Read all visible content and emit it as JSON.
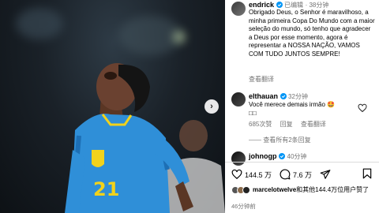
{
  "post": {
    "author": "endrick",
    "edited": "已编辑",
    "time": "38分钟",
    "caption": "Obrigado Deus, o Senhor é maravilhoso, a minha primeira Copa Do Mundo com a maior seleção do mundo, só tenho que agradecer a Deus por esse momento, agora é representar a NOSSA NAÇÃO, VAMOS COM TUDO JUNTOS SEMPRE!",
    "see_translation": "查看翻译"
  },
  "comments": [
    {
      "user": "elthauan",
      "time": "32分钟",
      "text": "Você merece demais irmão 🤩",
      "likes": "685次赞",
      "reply": "回复",
      "see_translation": "查看翻译",
      "view_replies": "—— 查看所有2条回复"
    },
    {
      "user": "johnogp",
      "time": "40分钟"
    }
  ],
  "actions": {
    "likes": "144.5 万",
    "comments": "7.6 万"
  },
  "liked_by": {
    "user": "marcelotwelve",
    "rest": "和其他144.4万位用户赞了"
  },
  "timestamp": "46分钟前",
  "jersey_number": "21",
  "colors": {
    "accent": "#0095f6",
    "jersey": "#2f8fd8",
    "jersey_trim": "#f2d21b"
  }
}
